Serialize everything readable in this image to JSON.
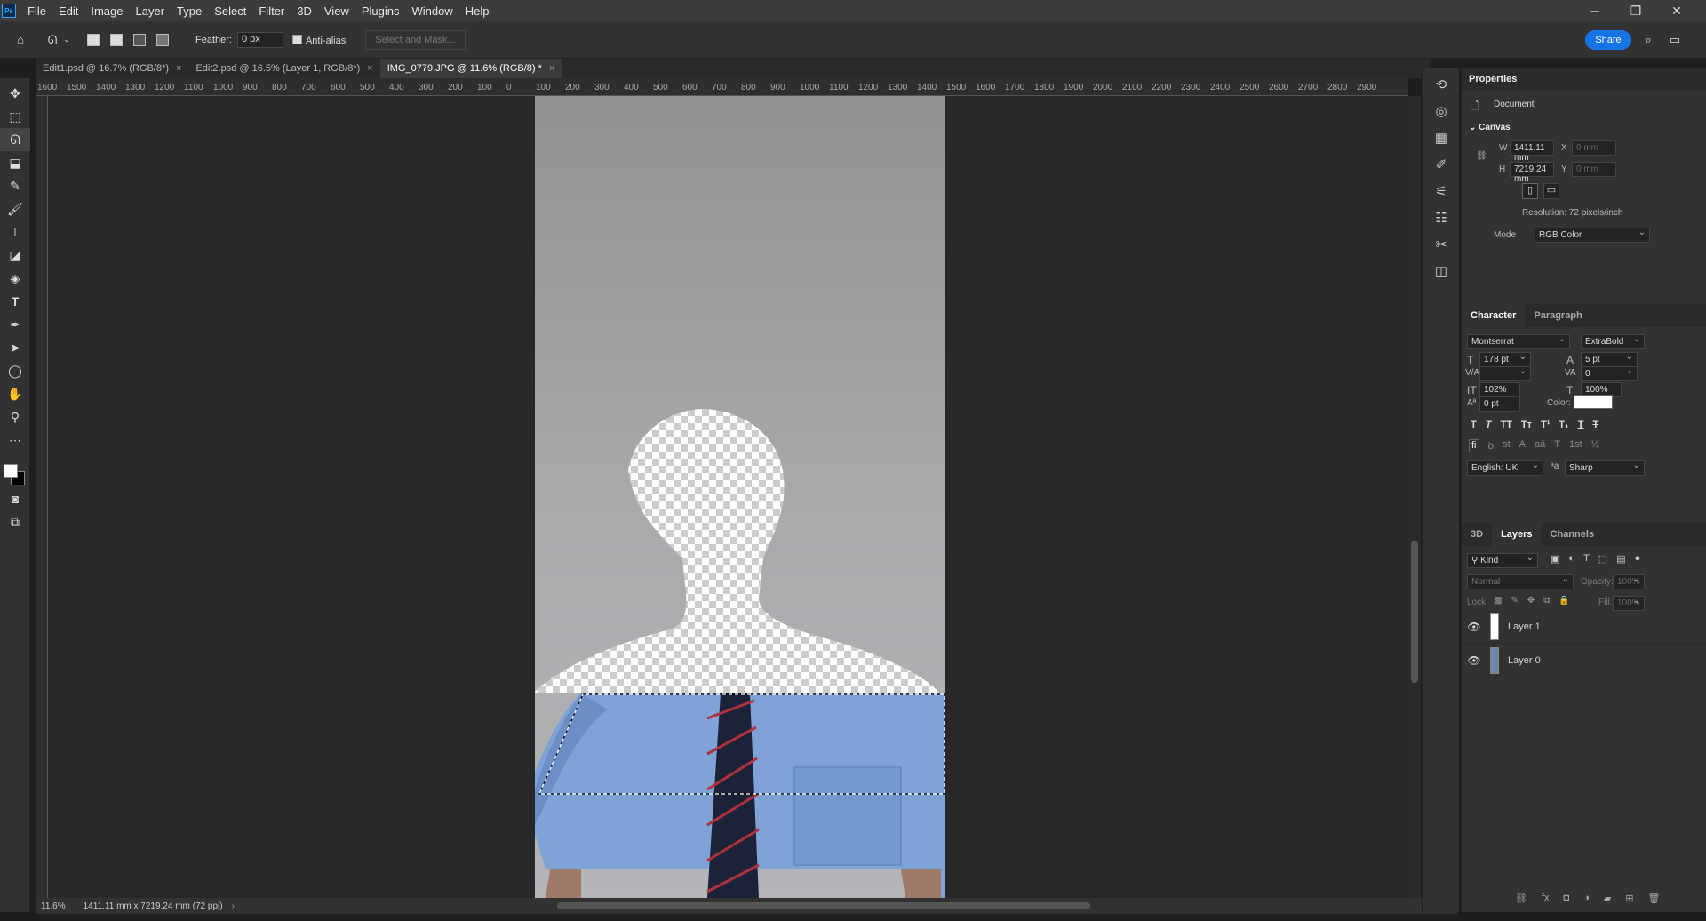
{
  "app": {
    "logo": "Ps"
  },
  "menu": [
    "File",
    "Edit",
    "Image",
    "Layer",
    "Type",
    "Select",
    "Filter",
    "3D",
    "View",
    "Plugins",
    "Window",
    "Help"
  ],
  "window_controls": {
    "minimize": "─",
    "maximize": "❐",
    "close": "✕"
  },
  "options": {
    "feather_label": "Feather:",
    "feather_value": "0 px",
    "antialias_label": "Anti-alias",
    "select_mask": "Select and Mask...",
    "share": "Share"
  },
  "tabs": [
    {
      "label": "Edit1.psd @ 16.7% (RGB/8*)"
    },
    {
      "label": "Edit2.psd @ 16.5% (Layer 1, RGB/8*)"
    },
    {
      "label": "IMG_0779.JPG @ 11.6% (RGB/8) *"
    }
  ],
  "tab_close": "×",
  "ruler_top": [
    "1600",
    "1500",
    "1400",
    "1300",
    "1200",
    "1100",
    "1000",
    "900",
    "800",
    "700",
    "600",
    "500",
    "400",
    "300",
    "200",
    "100",
    "0",
    "100",
    "200",
    "300",
    "400",
    "500",
    "600",
    "700",
    "800",
    "900",
    "1000",
    "1100",
    "1200",
    "1300",
    "1400",
    "1500",
    "1600",
    "1700",
    "1800",
    "1900",
    "2000",
    "2100",
    "2200",
    "2300",
    "2400",
    "2500",
    "2600",
    "2700",
    "2800",
    "2900"
  ],
  "status": {
    "zoom": "11.6%",
    "doc_size": "1411.11 mm x 7219.24 mm (72 ppi)"
  },
  "properties": {
    "title": "Properties",
    "document": "Document",
    "canvas": "Canvas",
    "w_label": "W",
    "w_value": "1411.11 mm",
    "h_label": "H",
    "h_value": "7219.24 mm",
    "x_label": "X",
    "x_placeholder": "0 mm",
    "y_label": "Y",
    "y_placeholder": "0 mm",
    "resolution": "Resolution: 72 pixels/inch",
    "mode_label": "Mode",
    "mode_value": "RGB Color"
  },
  "character": {
    "tab1": "Character",
    "tab2": "Paragraph",
    "font": "Montserrat",
    "style": "ExtraBold",
    "size": "178 pt",
    "leading": "5 pt",
    "kerning": "",
    "tracking": "0",
    "vscale": "102%",
    "hscale": "100%",
    "baseline": "0 pt",
    "color_label": "Color:",
    "language": "English: UK",
    "aa": "Sharp",
    "aa_label": "a"
  },
  "layers": {
    "tab_3d": "3D",
    "tab_layers": "Layers",
    "tab_channels": "Channels",
    "filter": "Kind",
    "blend": "Normal",
    "opacity_label": "Opacity:",
    "opacity": "100%",
    "lock_label": "Lock:",
    "fill_label": "Fill:",
    "fill": "100%",
    "items": [
      {
        "name": "Layer 1"
      },
      {
        "name": "Layer 0"
      }
    ]
  },
  "colors": {
    "accent": "#1473e6",
    "panel": "#323232",
    "canvas_bg": "#282828",
    "shirt": "#7fa3d6",
    "tie": "#1c2238"
  }
}
